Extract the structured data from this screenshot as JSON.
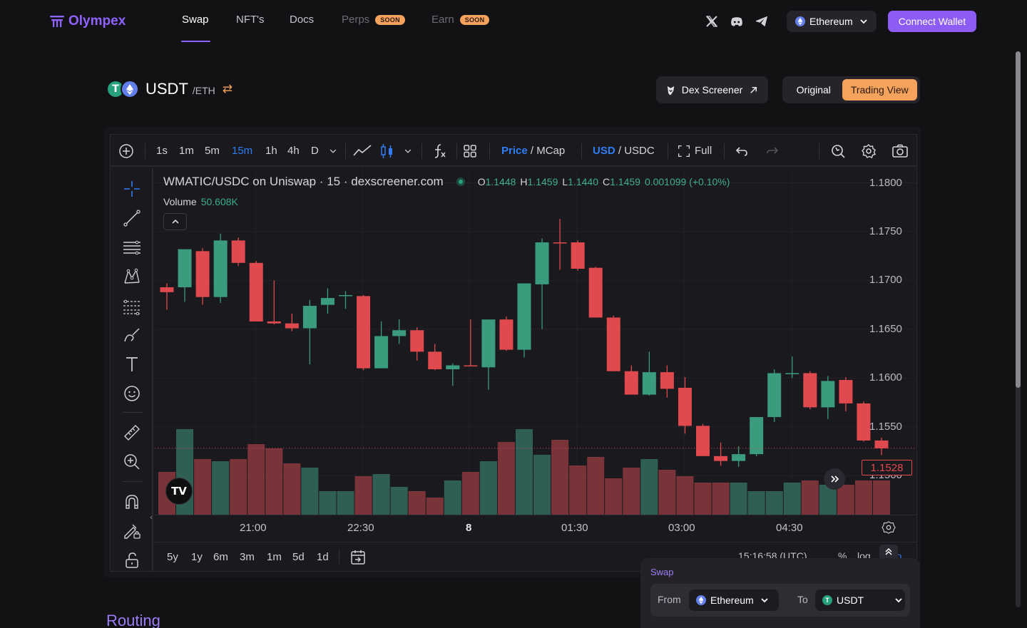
{
  "brand": {
    "name": "Olympex",
    "color": "#8f63ff"
  },
  "nav": {
    "items": [
      {
        "label": "Swap",
        "active": true
      },
      {
        "label": "NFT's"
      },
      {
        "label": "Docs"
      },
      {
        "label": "Perps",
        "badge": "SOON"
      },
      {
        "label": "Earn",
        "badge": "SOON"
      }
    ],
    "social": [
      "x-icon",
      "discord-icon",
      "telegram-icon"
    ],
    "network": "Ethereum",
    "connect_label": "Connect Wallet"
  },
  "token": {
    "symbol": "USDT",
    "pair": "/ETH",
    "swap_glyph": "⇄"
  },
  "dex_screener": {
    "label": "Dex Screener"
  },
  "view_toggle": {
    "original": "Original",
    "trading_view": "Trading View",
    "selected": "Trading View"
  },
  "toolbar": {
    "intervals": [
      "1s",
      "1m",
      "5m",
      "15m",
      "1h",
      "4h",
      "D"
    ],
    "selected_interval": "15m",
    "price_label": "Price",
    "mcap_label": "MCap",
    "usd_label": "USD",
    "usdc_label": "USDC",
    "full_label": "Full",
    "slash": "/"
  },
  "legend": {
    "title": "WMATIC/USDC on Uniswap · 15 · dexscreener.com",
    "o_label": "O",
    "o": "1.1448",
    "h_label": "H",
    "h": "1.1459",
    "l_label": "L",
    "l": "1.1440",
    "c_label": "C",
    "c": "1.1459",
    "change": "0.001099 (+0.10%)",
    "volume_label": "Volume",
    "volume": "50.608K"
  },
  "tv_logo": "TV",
  "range_bar": {
    "ranges": [
      "5y",
      "1y",
      "6m",
      "3m",
      "1m",
      "5d",
      "1d"
    ],
    "time": "15:16:58 (UTC)",
    "percent": "%",
    "log": "log",
    "auto": "auto"
  },
  "swap_widget": {
    "title": "Swap",
    "from_label": "From",
    "from_value": "Ethereum",
    "to_label": "To",
    "to_value": "USDT"
  },
  "routing_title": "Routing",
  "chart_data": {
    "type": "candlestick",
    "ylim": [
      1.146,
      1.1815
    ],
    "yticks": [
      "1.1800",
      "1.1750",
      "1.1700",
      "1.1650",
      "1.1600",
      "1.1550",
      "1.1500"
    ],
    "ytick_values": [
      1.18,
      1.175,
      1.17,
      1.165,
      1.16,
      1.155,
      1.15
    ],
    "current_price": "1.1528",
    "current_value": 1.1528,
    "xticks": [
      {
        "label": "21:00",
        "bold": false
      },
      {
        "label": "22:30",
        "bold": false
      },
      {
        "label": "8",
        "bold": true
      },
      {
        "label": "01:30",
        "bold": false
      },
      {
        "label": "03:00",
        "bold": false
      },
      {
        "label": "04:30",
        "bold": false
      }
    ],
    "colors": {
      "up": "#3a9b7d",
      "down": "#e04a4f",
      "vol_up": "#2f5f54",
      "vol_down": "#7a3339"
    },
    "candles": [
      {
        "o": 1.1693,
        "h": 1.1697,
        "l": 1.167,
        "c": 1.1688
      },
      {
        "o": 1.1693,
        "h": 1.173,
        "l": 1.1678,
        "c": 1.1732
      },
      {
        "o": 1.173,
        "h": 1.1733,
        "l": 1.1675,
        "c": 1.1683
      },
      {
        "o": 1.1683,
        "h": 1.1748,
        "l": 1.1677,
        "c": 1.1741
      },
      {
        "o": 1.1741,
        "h": 1.1744,
        "l": 1.1715,
        "c": 1.1718
      },
      {
        "o": 1.1718,
        "h": 1.172,
        "l": 1.1665,
        "c": 1.1658
      },
      {
        "o": 1.1658,
        "h": 1.17,
        "l": 1.1655,
        "c": 1.1656
      },
      {
        "o": 1.1656,
        "h": 1.1666,
        "l": 1.1648,
        "c": 1.1651
      },
      {
        "o": 1.1651,
        "h": 1.168,
        "l": 1.1614,
        "c": 1.1674
      },
      {
        "o": 1.1675,
        "h": 1.1692,
        "l": 1.1666,
        "c": 1.1682
      },
      {
        "o": 1.1685,
        "h": 1.1689,
        "l": 1.1671,
        "c": 1.1685
      },
      {
        "o": 1.1684,
        "h": 1.1685,
        "l": 1.1608,
        "c": 1.161
      },
      {
        "o": 1.161,
        "h": 1.1658,
        "l": 1.161,
        "c": 1.1643
      },
      {
        "o": 1.1643,
        "h": 1.166,
        "l": 1.1635,
        "c": 1.1649
      },
      {
        "o": 1.1649,
        "h": 1.1652,
        "l": 1.1618,
        "c": 1.1627
      },
      {
        "o": 1.1627,
        "h": 1.1635,
        "l": 1.1608,
        "c": 1.1609
      },
      {
        "o": 1.1609,
        "h": 1.1615,
        "l": 1.1592,
        "c": 1.1613
      },
      {
        "o": 1.1613,
        "h": 1.166,
        "l": 1.1612,
        "c": 1.1612
      },
      {
        "o": 1.1611,
        "h": 1.166,
        "l": 1.1588,
        "c": 1.166
      },
      {
        "o": 1.166,
        "h": 1.1663,
        "l": 1.1628,
        "c": 1.1629
      },
      {
        "o": 1.1629,
        "h": 1.1678,
        "l": 1.1621,
        "c": 1.1697
      },
      {
        "o": 1.1696,
        "h": 1.1743,
        "l": 1.165,
        "c": 1.1739
      },
      {
        "o": 1.1739,
        "h": 1.1763,
        "l": 1.1711,
        "c": 1.1738
      },
      {
        "o": 1.1739,
        "h": 1.1741,
        "l": 1.171,
        "c": 1.1712
      },
      {
        "o": 1.1713,
        "h": 1.1714,
        "l": 1.1665,
        "c": 1.1662
      },
      {
        "o": 1.1662,
        "h": 1.1664,
        "l": 1.1607,
        "c": 1.1607
      },
      {
        "o": 1.1607,
        "h": 1.1613,
        "l": 1.1593,
        "c": 1.1583
      },
      {
        "o": 1.1583,
        "h": 1.1627,
        "l": 1.1582,
        "c": 1.1606
      },
      {
        "o": 1.1606,
        "h": 1.1613,
        "l": 1.158,
        "c": 1.1589
      },
      {
        "o": 1.159,
        "h": 1.1601,
        "l": 1.1543,
        "c": 1.1551
      },
      {
        "o": 1.1551,
        "h": 1.1553,
        "l": 1.1526,
        "c": 1.152
      },
      {
        "o": 1.152,
        "h": 1.1534,
        "l": 1.151,
        "c": 1.1515
      },
      {
        "o": 1.1515,
        "h": 1.153,
        "l": 1.1509,
        "c": 1.1522
      },
      {
        "o": 1.1522,
        "h": 1.1559,
        "l": 1.152,
        "c": 1.156
      },
      {
        "o": 1.156,
        "h": 1.1609,
        "l": 1.1555,
        "c": 1.1605
      },
      {
        "o": 1.1605,
        "h": 1.1622,
        "l": 1.16,
        "c": 1.1605
      },
      {
        "o": 1.1605,
        "h": 1.1607,
        "l": 1.1568,
        "c": 1.157
      },
      {
        "o": 1.157,
        "h": 1.1602,
        "l": 1.1558,
        "c": 1.1597
      },
      {
        "o": 1.1598,
        "h": 1.1601,
        "l": 1.1566,
        "c": 1.1574
      },
      {
        "o": 1.1574,
        "h": 1.1576,
        "l": 1.1535,
        "c": 1.1536
      },
      {
        "o": 1.1536,
        "h": 1.1539,
        "l": 1.1521,
        "c": 1.1528
      }
    ],
    "volumes": [
      0.2,
      0.4,
      0.26,
      0.25,
      0.26,
      0.33,
      0.31,
      0.24,
      0.22,
      0.11,
      0.11,
      0.18,
      0.19,
      0.13,
      0.11,
      0.08,
      0.16,
      0.2,
      0.25,
      0.34,
      0.4,
      0.28,
      0.35,
      0.23,
      0.27,
      0.17,
      0.22,
      0.26,
      0.21,
      0.18,
      0.15,
      0.15,
      0.15,
      0.11,
      0.11,
      0.15,
      0.16,
      0.14,
      0.14,
      0.16,
      0.16
    ]
  }
}
